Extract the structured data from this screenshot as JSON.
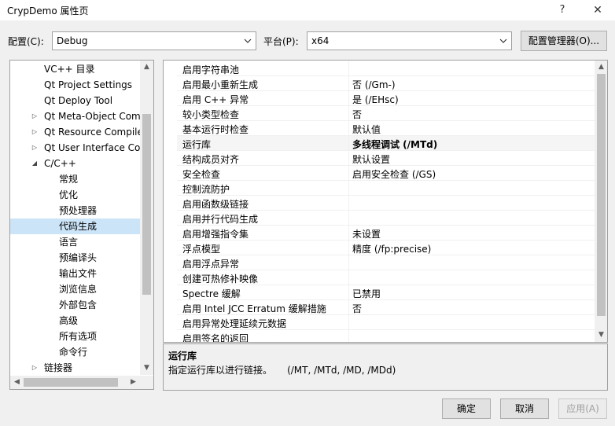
{
  "window": {
    "title": "CrypDemo 属性页",
    "help": "?",
    "close": "✕"
  },
  "config": {
    "config_label": "配置(C):",
    "config_value": "Debug",
    "platform_label": "平台(P):",
    "platform_value": "x64",
    "manager_button": "配置管理器(O)..."
  },
  "tree": {
    "items": [
      {
        "label": "VC++ 目录",
        "expander": ""
      },
      {
        "label": "Qt Project Settings",
        "expander": ""
      },
      {
        "label": "Qt Deploy Tool",
        "expander": ""
      },
      {
        "label": "Qt Meta-Object Compiler",
        "expander": "▷"
      },
      {
        "label": "Qt Resource Compiler",
        "expander": "▷"
      },
      {
        "label": "Qt User Interface Compiler",
        "expander": "▷"
      },
      {
        "label": "C/C++",
        "expander": "◢"
      },
      {
        "label": "常规",
        "expander": ""
      },
      {
        "label": "优化",
        "expander": ""
      },
      {
        "label": "预处理器",
        "expander": ""
      },
      {
        "label": "代码生成",
        "expander": ""
      },
      {
        "label": "语言",
        "expander": ""
      },
      {
        "label": "预编译头",
        "expander": ""
      },
      {
        "label": "输出文件",
        "expander": ""
      },
      {
        "label": "浏览信息",
        "expander": ""
      },
      {
        "label": "外部包含",
        "expander": ""
      },
      {
        "label": "高级",
        "expander": ""
      },
      {
        "label": "所有选项",
        "expander": ""
      },
      {
        "label": "命令行",
        "expander": ""
      },
      {
        "label": "链接器",
        "expander": "▷"
      }
    ],
    "selected_index": 10
  },
  "properties": {
    "rows": [
      {
        "name": "启用字符串池",
        "value": ""
      },
      {
        "name": "启用最小重新生成",
        "value": "否 (/Gm-)"
      },
      {
        "name": "启用 C++ 异常",
        "value": "是 (/EHsc)"
      },
      {
        "name": "较小类型检查",
        "value": "否"
      },
      {
        "name": "基本运行时检查",
        "value": "默认值"
      },
      {
        "name": "运行库",
        "value": "多线程调试 (/MTd)"
      },
      {
        "name": "结构成员对齐",
        "value": "默认设置"
      },
      {
        "name": "安全检查",
        "value": "启用安全检查 (/GS)"
      },
      {
        "name": "控制流防护",
        "value": ""
      },
      {
        "name": "启用函数级链接",
        "value": ""
      },
      {
        "name": "启用并行代码生成",
        "value": ""
      },
      {
        "name": "启用增强指令集",
        "value": "未设置"
      },
      {
        "name": "浮点模型",
        "value": "精度 (/fp:precise)"
      },
      {
        "name": "启用浮点异常",
        "value": ""
      },
      {
        "name": "创建可热修补映像",
        "value": ""
      },
      {
        "name": "Spectre 缓解",
        "value": "已禁用"
      },
      {
        "name": "启用 Intel JCC Erratum 缓解措施",
        "value": "否"
      },
      {
        "name": "启用异常处理延续元数据",
        "value": ""
      },
      {
        "name": "启用签名的返回",
        "value": ""
      }
    ],
    "highlighted_index": 5
  },
  "description": {
    "title": "运行库",
    "text": "指定运行库以进行链接。     (/MT, /MTd, /MD, /MDd)"
  },
  "buttons": {
    "ok": "确定",
    "cancel": "取消",
    "apply": "应用(A)"
  },
  "colors": {
    "selection": "#cce4f7",
    "highlight_row": "#f5f5f5"
  }
}
